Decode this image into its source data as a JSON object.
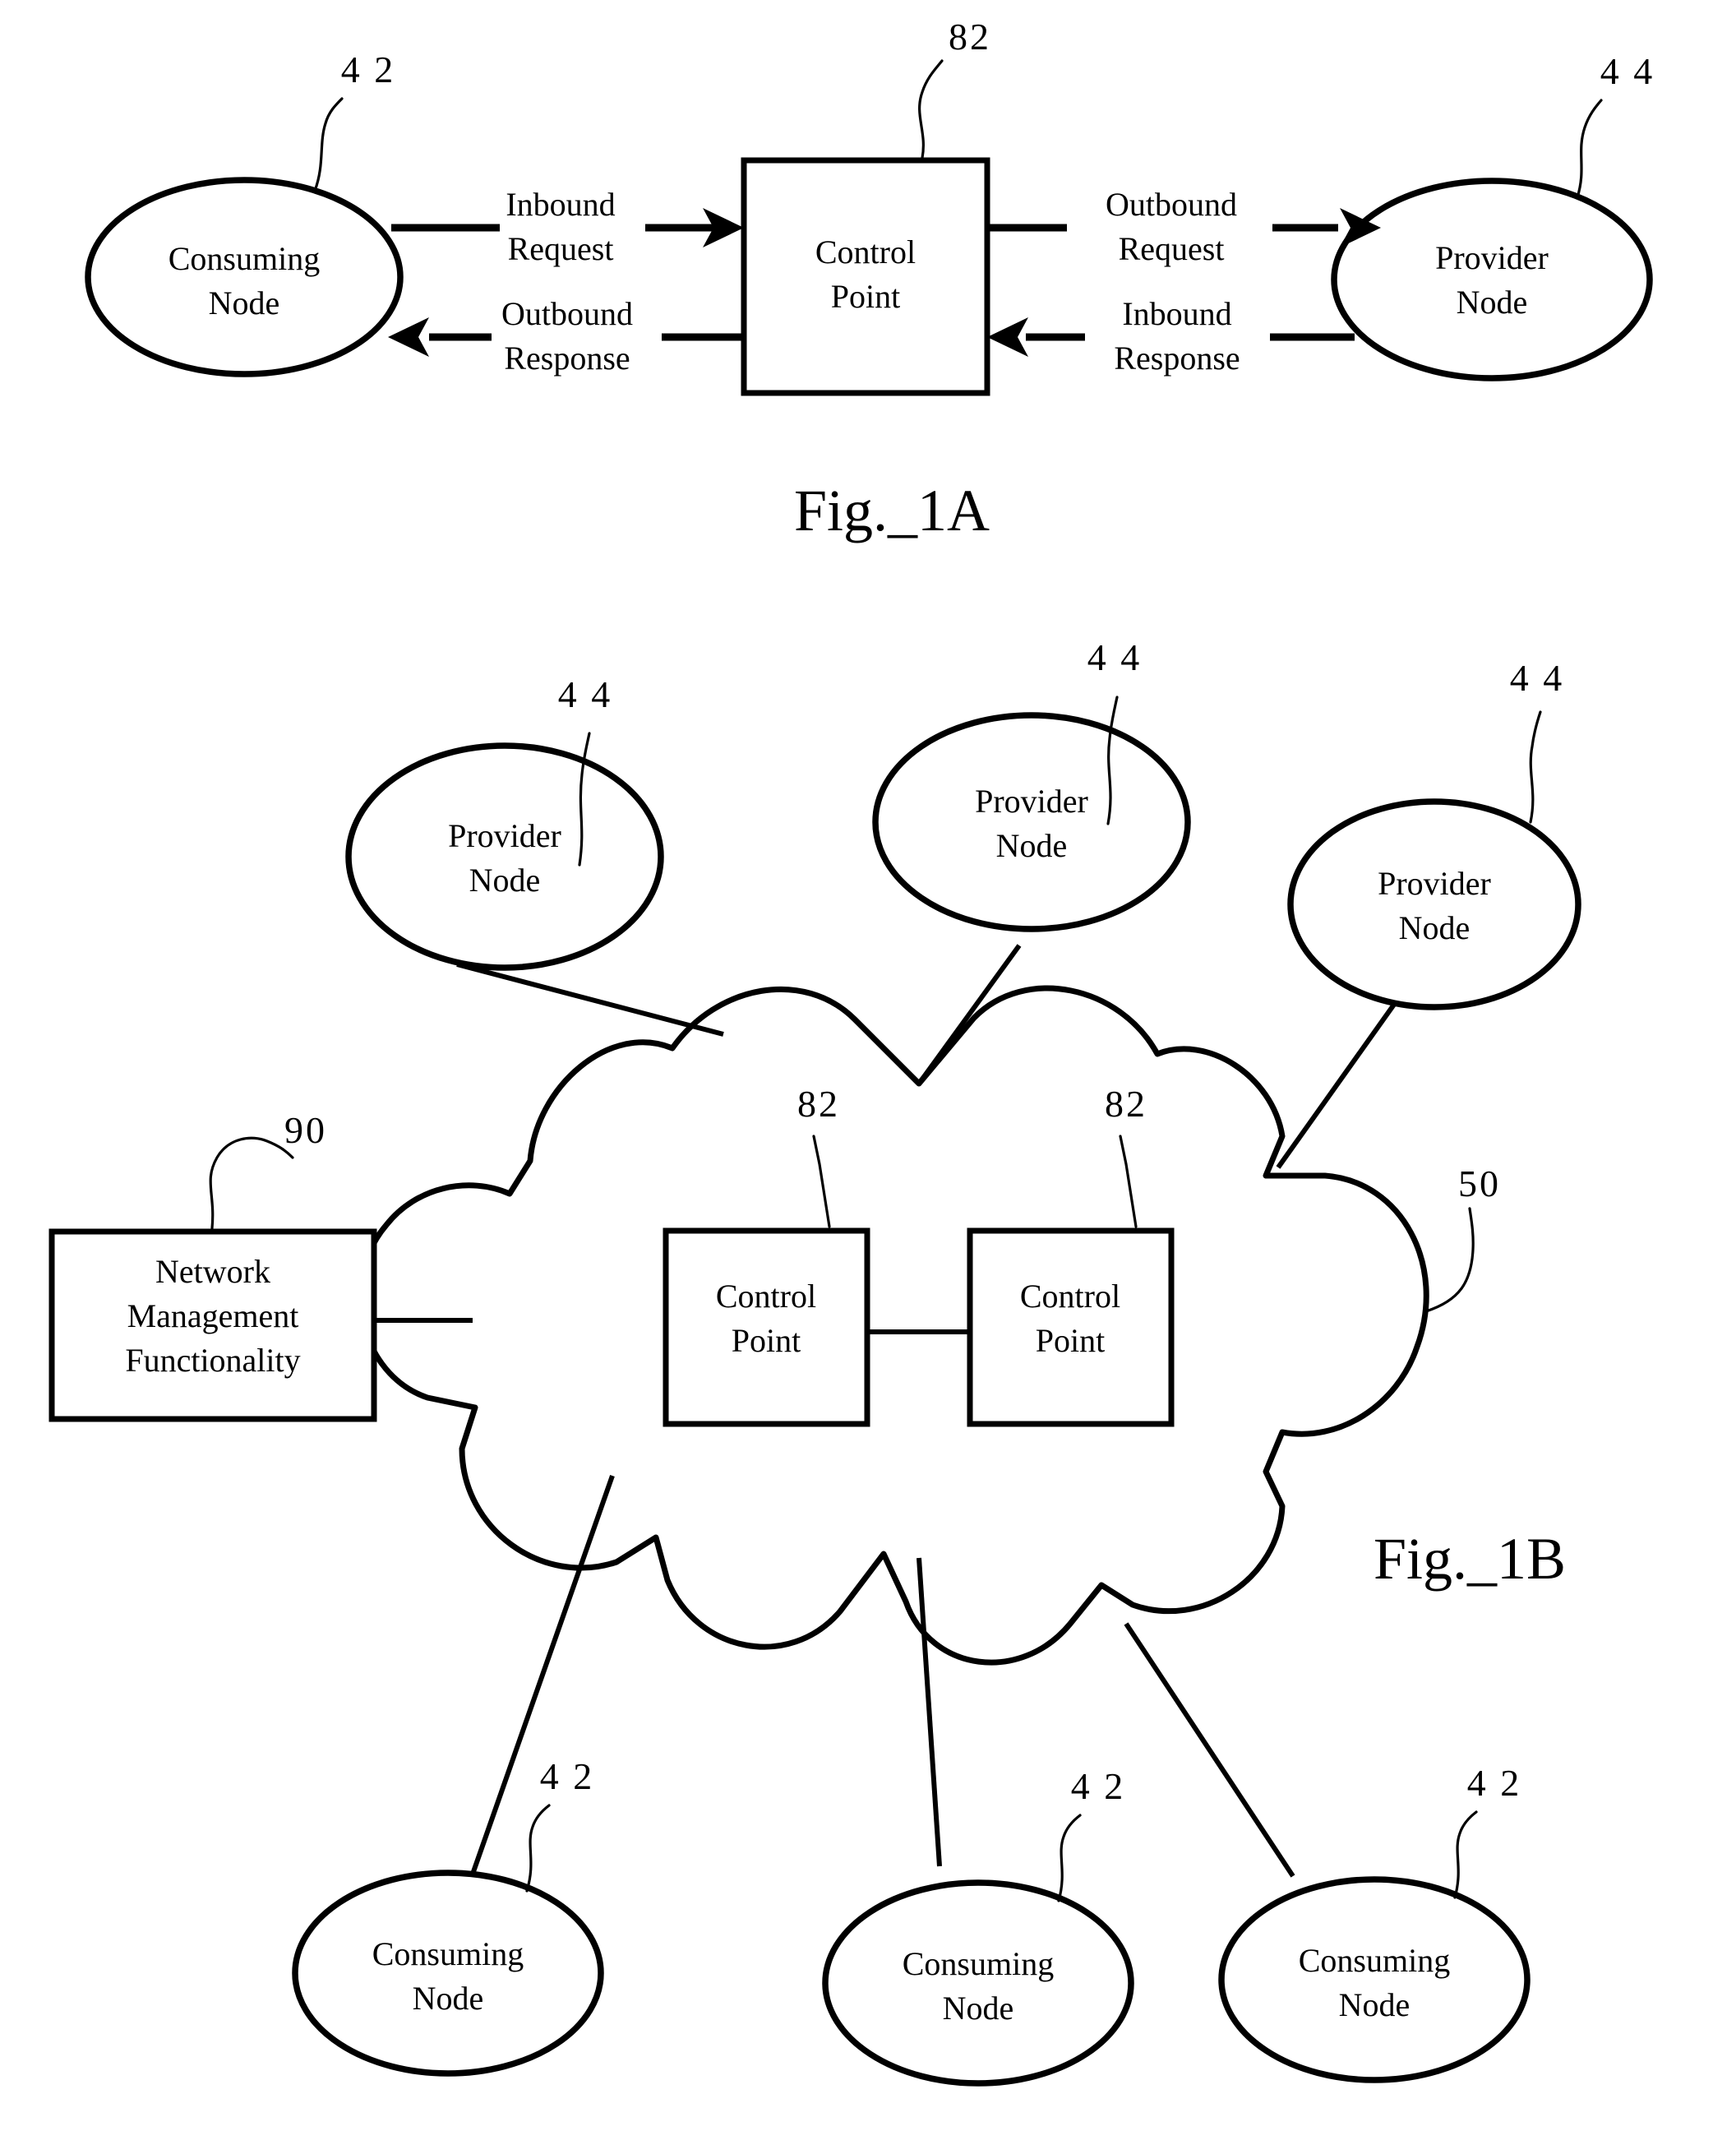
{
  "figures": [
    {
      "id": "fig-1a",
      "caption": "Fig._1A",
      "nodes": {
        "consuming": {
          "line1": "Consuming",
          "line2": "Node",
          "ref": "4 2"
        },
        "control_point": {
          "line1": "Control",
          "line2": "Point",
          "ref": "82"
        },
        "provider": {
          "line1": "Provider",
          "line2": "Node",
          "ref": "4 4"
        }
      },
      "edges": [
        {
          "id": "inbound-request",
          "line1": "Inbound",
          "line2": "Request",
          "direction": "right"
        },
        {
          "id": "outbound-response",
          "line1": "Outbound",
          "line2": "Response",
          "direction": "left"
        },
        {
          "id": "outbound-request",
          "line1": "Outbound",
          "line2": "Request",
          "direction": "right"
        },
        {
          "id": "inbound-response",
          "line1": "Inbound",
          "line2": "Response",
          "direction": "left"
        }
      ]
    },
    {
      "id": "fig-1b",
      "caption": "Fig._1B",
      "cloud": {
        "ref": "50"
      },
      "nmf": {
        "line1": "Network",
        "line2": "Management",
        "line3": "Functionality",
        "ref": "90"
      },
      "control_points": [
        {
          "line1": "Control",
          "line2": "Point",
          "ref": "82"
        },
        {
          "line1": "Control",
          "line2": "Point",
          "ref": "82"
        }
      ],
      "providers": [
        {
          "line1": "Provider",
          "line2": "Node",
          "ref": "4 4"
        },
        {
          "line1": "Provider",
          "line2": "Node",
          "ref": "4 4"
        },
        {
          "line1": "Provider",
          "line2": "Node",
          "ref": "4 4"
        }
      ],
      "consumers": [
        {
          "line1": "Consuming",
          "line2": "Node",
          "ref": "4 2"
        },
        {
          "line1": "Consuming",
          "line2": "Node",
          "ref": "4 2"
        },
        {
          "line1": "Consuming",
          "line2": "Node",
          "ref": "4 2"
        }
      ]
    }
  ],
  "colors": {
    "ink": "#000000",
    "paper": "#ffffff"
  },
  "chart_data": {
    "type": "diagram",
    "title": "Fig._1A / Fig._1B network control point diagrams",
    "figure_1a": {
      "caption": "Fig._1A",
      "elements": [
        {
          "label": "Consuming Node",
          "ref": "42",
          "shape": "ellipse"
        },
        {
          "label": "Control Point",
          "ref": "82",
          "shape": "rectangle"
        },
        {
          "label": "Provider Node",
          "ref": "44",
          "shape": "ellipse"
        }
      ],
      "connections": [
        {
          "from": "Consuming Node",
          "to": "Control Point",
          "label": "Inbound Request"
        },
        {
          "from": "Control Point",
          "to": "Consuming Node",
          "label": "Outbound Response"
        },
        {
          "from": "Control Point",
          "to": "Provider Node",
          "label": "Outbound Request"
        },
        {
          "from": "Provider Node",
          "to": "Control Point",
          "label": "Inbound Response"
        }
      ]
    },
    "figure_1b": {
      "caption": "Fig._1B",
      "elements": [
        {
          "label": "Network cloud",
          "ref": "50",
          "shape": "cloud"
        },
        {
          "label": "Network Management Functionality",
          "ref": "90",
          "shape": "rectangle"
        },
        {
          "label": "Control Point",
          "ref": "82",
          "shape": "rectangle"
        },
        {
          "label": "Control Point",
          "ref": "82",
          "shape": "rectangle"
        },
        {
          "label": "Provider Node",
          "ref": "44",
          "shape": "ellipse"
        },
        {
          "label": "Provider Node",
          "ref": "44",
          "shape": "ellipse"
        },
        {
          "label": "Provider Node",
          "ref": "44",
          "shape": "ellipse"
        },
        {
          "label": "Consuming Node",
          "ref": "42",
          "shape": "ellipse"
        },
        {
          "label": "Consuming Node",
          "ref": "42",
          "shape": "ellipse"
        },
        {
          "label": "Consuming Node",
          "ref": "42",
          "shape": "ellipse"
        }
      ],
      "connections": [
        {
          "from": "Provider Node",
          "to": "Network cloud"
        },
        {
          "from": "Provider Node",
          "to": "Network cloud"
        },
        {
          "from": "Provider Node",
          "to": "Network cloud"
        },
        {
          "from": "Network Management Functionality",
          "to": "Network cloud"
        },
        {
          "from": "Control Point",
          "to": "Control Point"
        },
        {
          "from": "Network cloud",
          "to": "Consuming Node"
        },
        {
          "from": "Network cloud",
          "to": "Consuming Node"
        },
        {
          "from": "Network cloud",
          "to": "Consuming Node"
        }
      ]
    }
  }
}
